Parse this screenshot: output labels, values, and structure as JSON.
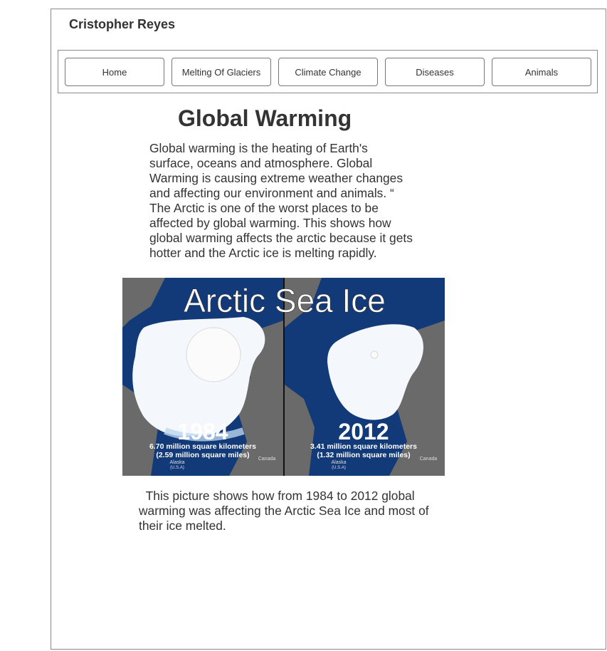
{
  "site": {
    "owner_name": "Cristopher Reyes"
  },
  "nav": {
    "items": [
      {
        "label": "Home"
      },
      {
        "label": "Melting Of Glaciers"
      },
      {
        "label": "Climate Change"
      },
      {
        "label": "Diseases"
      },
      {
        "label": "Animals"
      }
    ]
  },
  "main": {
    "title": "Global Warming",
    "intro": "Global warming is the heating of Earth's surface, oceans and atmosphere. Global Warming is causing extreme weather changes and affecting our environment and animals. “ The Arctic is one of the worst places to be affected by global warming. This shows how global warming affects the arctic because it gets hotter and the Arctic ice is melting rapidly.",
    "figure": {
      "title": "Arctic Sea Ice",
      "left": {
        "year": "1984",
        "area_km": "6.70 million square kilometers",
        "area_mi": "(2.59 million square miles)",
        "place1": "Alaska",
        "place1_sub": "(U.S.A)",
        "place2": "Canada"
      },
      "right": {
        "year": "2012",
        "area_km": "3.41 million square kilometers",
        "area_mi": "(1.32 million square miles)",
        "place1": "Alaska",
        "place1_sub": "(U.S.A)",
        "place2": "Canada"
      },
      "colors": {
        "ocean": "#123a78",
        "land": "#6a6a6a",
        "ice": "#f4f8fc"
      }
    },
    "caption": "This picture shows how from 1984 to 2012 global warming was affecting the Arctic Sea Ice and most of their ice melted."
  }
}
